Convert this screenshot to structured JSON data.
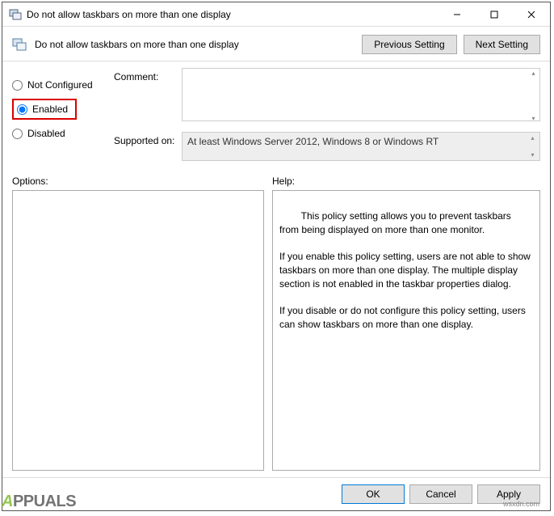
{
  "window": {
    "title": "Do not allow taskbars on more than one display"
  },
  "header": {
    "policyTitle": "Do not allow taskbars on more than one display",
    "prevButton": "Previous Setting",
    "nextButton": "Next Setting"
  },
  "radios": {
    "notConfigured": "Not Configured",
    "enabled": "Enabled",
    "disabled": "Disabled",
    "selected": "enabled"
  },
  "fields": {
    "commentLabel": "Comment:",
    "commentValue": "",
    "supportedLabel": "Supported on:",
    "supportedValue": "At least Windows Server 2012, Windows 8 or Windows RT"
  },
  "panes": {
    "optionsLabel": "Options:",
    "helpLabel": "Help:",
    "helpText": "This policy setting allows you to prevent taskbars from being displayed on more than one monitor.\n\nIf you enable this policy setting, users are not able to show taskbars on more than one display. The multiple display section is not enabled in the taskbar properties dialog.\n\nIf you disable or do not configure this policy setting, users can show taskbars on more than one display."
  },
  "footer": {
    "ok": "OK",
    "cancel": "Cancel",
    "apply": "Apply"
  },
  "watermark": {
    "site": "wsxdn.com"
  }
}
